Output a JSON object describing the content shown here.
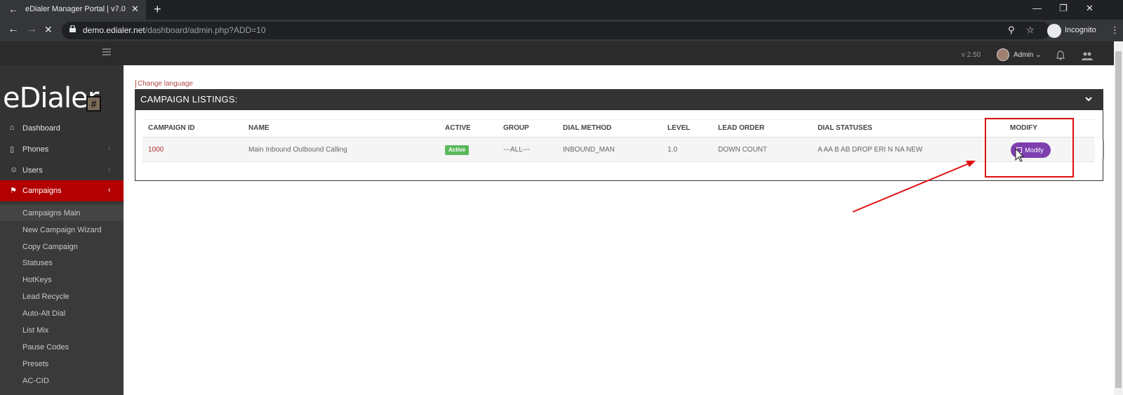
{
  "browser": {
    "tab_title": "eDialer Manager Portal | v7.0",
    "url_host": "demo.edialer.net",
    "url_path": "/dashboard/admin.php?ADD=10",
    "profile_label": "Incognito"
  },
  "topbar": {
    "version": "v 2.50",
    "user": "Admin"
  },
  "sidebar": {
    "logo_text": "eDialer",
    "logo_badge": "#",
    "items": [
      {
        "label": "Dashboard",
        "icon": "home-icon"
      },
      {
        "label": "Phones",
        "icon": "phone-icon"
      },
      {
        "label": "Users",
        "icon": "users-icon"
      },
      {
        "label": "Campaigns",
        "icon": "flag-icon"
      }
    ],
    "submenu": [
      "Campaigns Main",
      "New Campaign Wizard",
      "Copy Campaign",
      "Statuses",
      "HotKeys",
      "Lead Recycle",
      "Auto-Alt Dial",
      "List Mix",
      "Pause Codes",
      "Presets",
      "AC-CID"
    ]
  },
  "content": {
    "change_language": "Change language",
    "panel_title": "CAMPAIGN LISTINGS:",
    "columns": [
      "CAMPAIGN ID",
      "NAME",
      "ACTIVE",
      "GROUP",
      "DIAL METHOD",
      "LEVEL",
      "LEAD ORDER",
      "DIAL STATUSES",
      "MODIFY"
    ],
    "rows": [
      {
        "campaign_id": "1000",
        "name": "Main Inbound Outbound Calling",
        "active": "Active",
        "group": "---ALL---",
        "dial_method": "INBOUND_MAN",
        "level": "1.0",
        "lead_order": "DOWN COUNT",
        "dial_statuses": "A AA B AB DROP ERI N NA NEW",
        "modify": "Modify"
      }
    ]
  },
  "colors": {
    "accent_red": "#b30000",
    "modify_purple": "#7e3fb0",
    "active_green": "#5cb85c",
    "annotation_red": "#e01010"
  }
}
